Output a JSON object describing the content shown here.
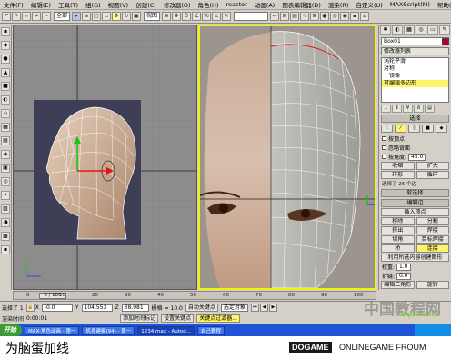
{
  "menu": [
    "文件(F)",
    "编辑(E)",
    "工具(T)",
    "组(G)",
    "视图(V)",
    "创建(C)",
    "修改器(O)",
    "角色(H)",
    "reactor",
    "动画(A)",
    "图表编辑器(D)",
    "渲染(R)",
    "自定义(U)",
    "MAXScript(M)",
    "帮助(H)"
  ],
  "toolbar": {
    "selection_filter": "全部",
    "view_dropdown": "视图",
    "named_selection": ""
  },
  "command_panel": {
    "object_name": "Box01",
    "modifier_list_label": "修改器列表",
    "modifier_stack": [
      {
        "label": "涡轮平滑",
        "selected": false
      },
      {
        "label": "对称",
        "selected": false
      },
      {
        "label": "镜像",
        "selected": false
      },
      {
        "label": "可编辑多边形",
        "selected": true
      }
    ],
    "rollout_selection": "选择",
    "by_vertex": "按顶点",
    "ignore_backfacing": "忽略背面",
    "by_angle": "按角度:",
    "angle_value": "45.0",
    "shrink": "收缩",
    "grow": "扩大",
    "ring": "环形",
    "loop": "循环",
    "selection_status": "选择了 26 个边",
    "rollout_soft": "软选择",
    "rollout_edit_edges": "编辑边",
    "insert_vertex": "插入顶点",
    "remove": "移除",
    "split": "分割",
    "extrude": "挤出",
    "weld": "焊接",
    "chamfer": "切角",
    "target_weld": "目标焊接",
    "bridge": "桥",
    "connect": "连接",
    "create_shape": "利用所选内容创建图形",
    "weight_label": "权重:",
    "weight_value": "1.0",
    "crease_label": "折缝:",
    "crease_value": "0.0",
    "edit_tri": "编辑三角形",
    "turn": "旋转"
  },
  "timeline": {
    "frame_display": "0 / 100",
    "ticks": [
      "0",
      "10",
      "20",
      "30",
      "40",
      "50",
      "60",
      "70",
      "80",
      "90",
      "100"
    ]
  },
  "status": {
    "selected_count": "选择了 1",
    "x_label": "X",
    "x_value": "-0.0",
    "y_label": "Y",
    "y_value": "104.553",
    "z_label": "Z",
    "z_value": "38.981",
    "grid_label": "栅格 = 10.0",
    "auto_key": "自动关键点",
    "selected_object": "选定对象",
    "set_key": "设置关键点",
    "key_filters": "关键点过滤器...",
    "render_time_label": "渲染时间",
    "render_time_value": "0:00:01",
    "add_time_tag": "添加时间标记"
  },
  "taskbar": {
    "start": "开始",
    "tasks": [
      "MAX-角色动画 - 第一",
      "机身建模(94) - 第一",
      "1234.max - Autod...",
      "自己教程"
    ]
  },
  "caption": "为脑蛋加线",
  "watermark": {
    "brand": "DOGAME",
    "forum": "ONLINEGAME FROUM",
    "cn": "中国教程网",
    "en": "3D.jcwcn.com"
  }
}
